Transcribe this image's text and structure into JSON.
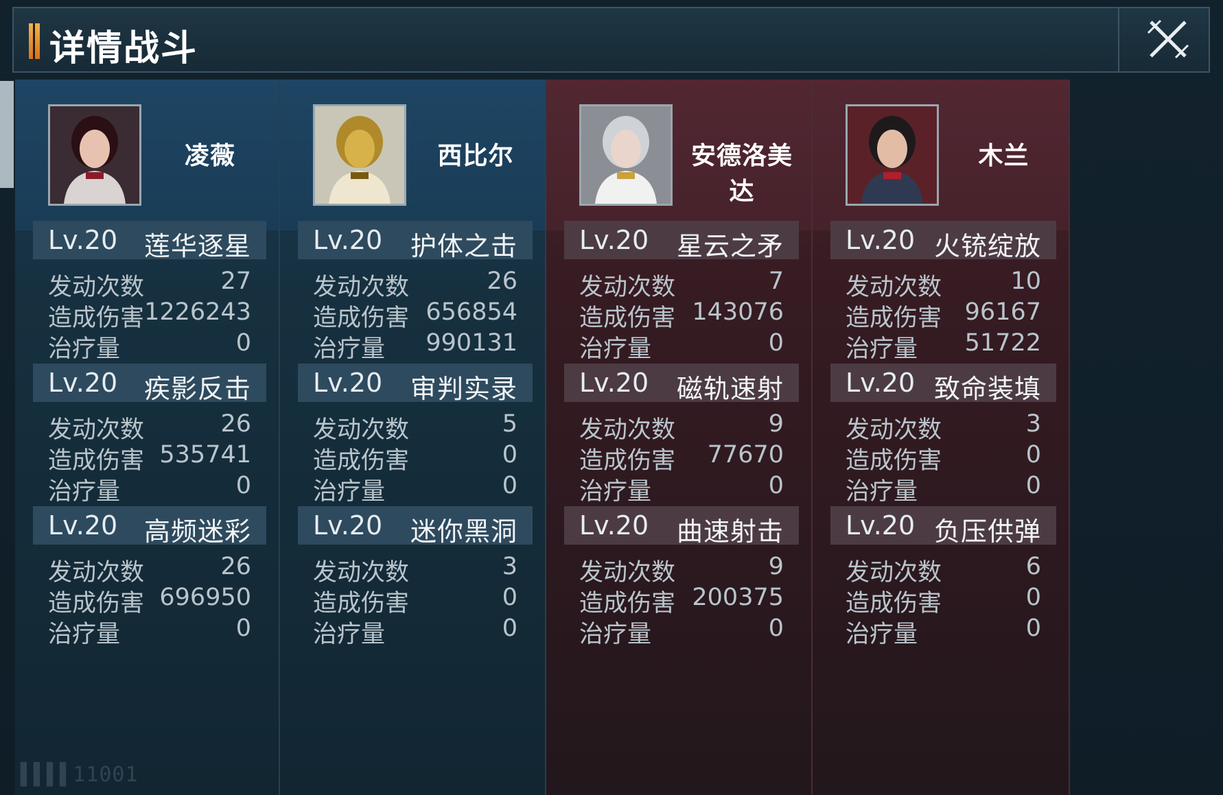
{
  "title": "详情战斗",
  "watermark": "▌▌▌▌11001",
  "colors": {
    "team_left": "#1b3a52",
    "team_right": "#4a2329",
    "accent": "#f0b24a"
  },
  "heroes": [
    {
      "name": "凌薇",
      "team": "blue",
      "avatar_icon": "hero-portrait-icon",
      "skills": [
        {
          "level": "Lv.20",
          "name": "莲华逐星",
          "stats": [
            {
              "label": "发动次数",
              "value": "27"
            },
            {
              "label": "造成伤害",
              "value": "1226243"
            },
            {
              "label": "治疗量",
              "value": "0"
            }
          ]
        },
        {
          "level": "Lv.20",
          "name": "疾影反击",
          "stats": [
            {
              "label": "发动次数",
              "value": "26"
            },
            {
              "label": "造成伤害",
              "value": "535741"
            },
            {
              "label": "治疗量",
              "value": "0"
            }
          ]
        },
        {
          "level": "Lv.20",
          "name": "高频迷彩",
          "stats": [
            {
              "label": "发动次数",
              "value": "26"
            },
            {
              "label": "造成伤害",
              "value": "696950"
            },
            {
              "label": "治疗量",
              "value": "0"
            }
          ]
        }
      ]
    },
    {
      "name": "西比尔",
      "team": "blue",
      "avatar_icon": "hero-portrait-icon",
      "skills": [
        {
          "level": "Lv.20",
          "name": "护体之击",
          "stats": [
            {
              "label": "发动次数",
              "value": "26"
            },
            {
              "label": "造成伤害",
              "value": "656854"
            },
            {
              "label": "治疗量",
              "value": "990131"
            }
          ]
        },
        {
          "level": "Lv.20",
          "name": "审判实录",
          "stats": [
            {
              "label": "发动次数",
              "value": "5"
            },
            {
              "label": "造成伤害",
              "value": "0"
            },
            {
              "label": "治疗量",
              "value": "0"
            }
          ]
        },
        {
          "level": "Lv.20",
          "name": "迷你黑洞",
          "stats": [
            {
              "label": "发动次数",
              "value": "3"
            },
            {
              "label": "造成伤害",
              "value": "0"
            },
            {
              "label": "治疗量",
              "value": "0"
            }
          ]
        }
      ]
    },
    {
      "name": "安德洛美达",
      "team": "red",
      "avatar_icon": "hero-portrait-icon",
      "skills": [
        {
          "level": "Lv.20",
          "name": "星云之矛",
          "stats": [
            {
              "label": "发动次数",
              "value": "7"
            },
            {
              "label": "造成伤害",
              "value": "143076"
            },
            {
              "label": "治疗量",
              "value": "0"
            }
          ]
        },
        {
          "level": "Lv.20",
          "name": "磁轨速射",
          "stats": [
            {
              "label": "发动次数",
              "value": "9"
            },
            {
              "label": "造成伤害",
              "value": "77670"
            },
            {
              "label": "治疗量",
              "value": "0"
            }
          ]
        },
        {
          "level": "Lv.20",
          "name": "曲速射击",
          "stats": [
            {
              "label": "发动次数",
              "value": "9"
            },
            {
              "label": "造成伤害",
              "value": "200375"
            },
            {
              "label": "治疗量",
              "value": "0"
            }
          ]
        }
      ]
    },
    {
      "name": "木兰",
      "team": "red",
      "avatar_icon": "hero-portrait-icon",
      "skills": [
        {
          "level": "Lv.20",
          "name": "火铳绽放",
          "stats": [
            {
              "label": "发动次数",
              "value": "10"
            },
            {
              "label": "造成伤害",
              "value": "96167"
            },
            {
              "label": "治疗量",
              "value": "51722"
            }
          ]
        },
        {
          "level": "Lv.20",
          "name": "致命装填",
          "stats": [
            {
              "label": "发动次数",
              "value": "3"
            },
            {
              "label": "造成伤害",
              "value": "0"
            },
            {
              "label": "治疗量",
              "value": "0"
            }
          ]
        },
        {
          "level": "Lv.20",
          "name": "负压供弹",
          "stats": [
            {
              "label": "发动次数",
              "value": "6"
            },
            {
              "label": "造成伤害",
              "value": "0"
            },
            {
              "label": "治疗量",
              "value": "0"
            }
          ]
        }
      ]
    }
  ]
}
